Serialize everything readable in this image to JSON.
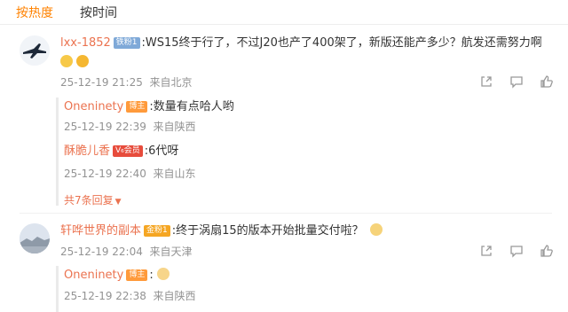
{
  "tabs": [
    "按热度",
    "按时间"
  ],
  "comments": [
    {
      "author": "lxx-1852",
      "badge": "铁粉1",
      "text": ":WS15终于行了，不过J20也产了400架了，新版还能产多少？航发还需努力啊",
      "time": "25-12-19 21:25",
      "location": "来自北京",
      "replies": [
        {
          "author": "Oneninety",
          "badge": "博主",
          "text": ":数量有点哈人哟",
          "time": "25-12-19 22:39",
          "location": "来自陕西"
        },
        {
          "author": "酥脆儿香",
          "badge": "V₆会员",
          "text": ":6代呀",
          "time": "25-12-19 22:40",
          "location": "来自山东"
        }
      ],
      "more_replies": "共7条回复"
    },
    {
      "author": "轩哗世界的副本",
      "badge": "金粉1",
      "text": ":终于涡扇15的版本开始批量交付啦？",
      "time": "25-12-19 22:04",
      "location": "来自天津",
      "replies": [
        {
          "author": "Oneninety",
          "badge": "博主",
          "text": ":",
          "time": "25-12-19 22:38",
          "location": "来自陕西"
        }
      ]
    }
  ],
  "icons": [
    "share-icon",
    "comment-icon",
    "like-icon"
  ],
  "colors": {
    "accent": "#ff8200",
    "name": "#eb7350",
    "meta": "#939393"
  }
}
